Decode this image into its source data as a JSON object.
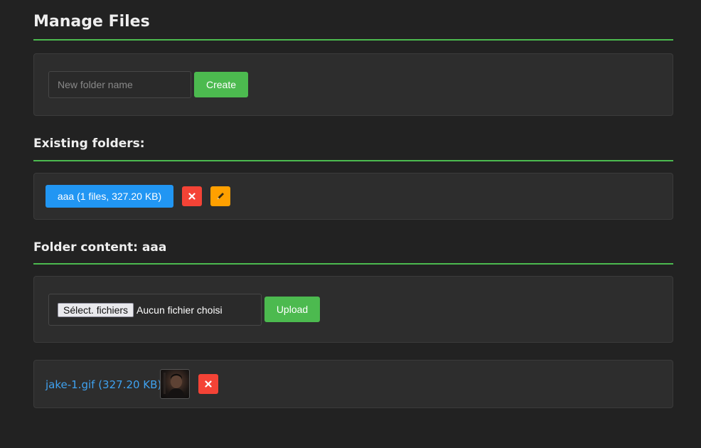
{
  "header": {
    "title": "Manage Files"
  },
  "create_folder": {
    "placeholder": "New folder name",
    "value": "",
    "create_label": "Create"
  },
  "existing": {
    "heading": "Existing folders:",
    "folders": [
      {
        "label": "aaa (1 files, 327.20 KB)",
        "delete_icon": "close-icon",
        "rename_icon": "pencil-icon"
      }
    ]
  },
  "content": {
    "heading": "Folder content: aaa",
    "picker_button": "Sélect. fichiers",
    "picker_status": "Aucun fichier choisi",
    "upload_label": "Upload",
    "files": [
      {
        "label": "jake-1.gif (327.20 KB)",
        "thumb_icon": "image-thumbnail",
        "delete_icon": "close-icon"
      }
    ]
  },
  "colors": {
    "background": "#222222",
    "accent_green": "#4cba4f",
    "folder_blue": "#2196f3",
    "danger_red": "#f44336",
    "rename_amber": "#ffa000",
    "link_blue": "#3fa2f0"
  }
}
